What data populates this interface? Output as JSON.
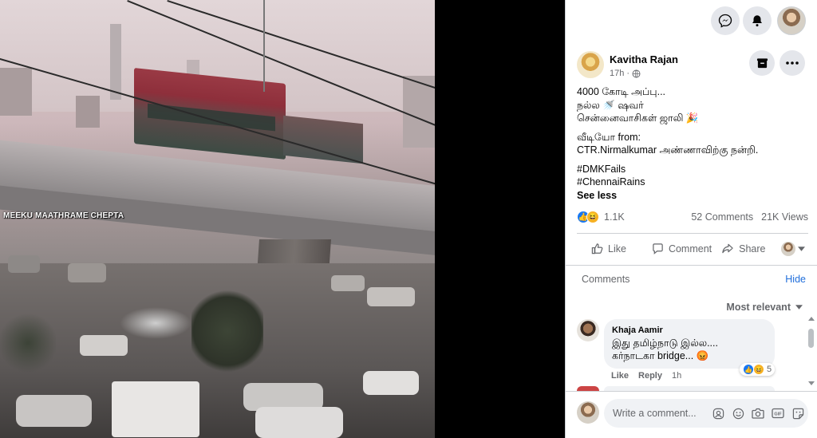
{
  "video": {
    "overlay_text": "MEEKU MAATHRAME CHEPTA"
  },
  "header": {
    "messenger_icon": "messenger-icon",
    "notifications_icon": "bell-icon",
    "profile_icon": "profile-avatar"
  },
  "post": {
    "author": "Kavitha Rajan",
    "time": "17h",
    "audience_icon": "globe-icon",
    "lines": [
      "4000 கோடி அப்பு...",
      "நல்ல 🚿 ஷவர்",
      "சென்னைவாசிகள் ஜாலி 🎉"
    ],
    "credit_label": "வீடியோ from:",
    "credit_text": "CTR.Nirmalkumar அண்ணாவிற்கு நன்றி.",
    "tags": [
      "#DMKFails",
      "#ChennaiRains"
    ],
    "see_less": "See less",
    "reaction_count": "1.1K",
    "comments_count": "52 Comments",
    "views_count": "21K Views",
    "actions": {
      "like": "Like",
      "comment": "Comment",
      "share": "Share"
    }
  },
  "comments_section": {
    "label": "Comments",
    "hide": "Hide",
    "sort": "Most relevant"
  },
  "comment1": {
    "name": "Khaja Aamir",
    "line1": "இது தமிழ்நாடு இல்ல....",
    "line2": "கர்நாடகா bridge... 😡",
    "like": "Like",
    "reply": "Reply",
    "time": "1h",
    "react_count": "5"
  },
  "composer": {
    "placeholder": "Write a comment..."
  },
  "colors": {
    "accent": "#1877f2",
    "link": "#216fdb",
    "muted": "#65676b"
  }
}
